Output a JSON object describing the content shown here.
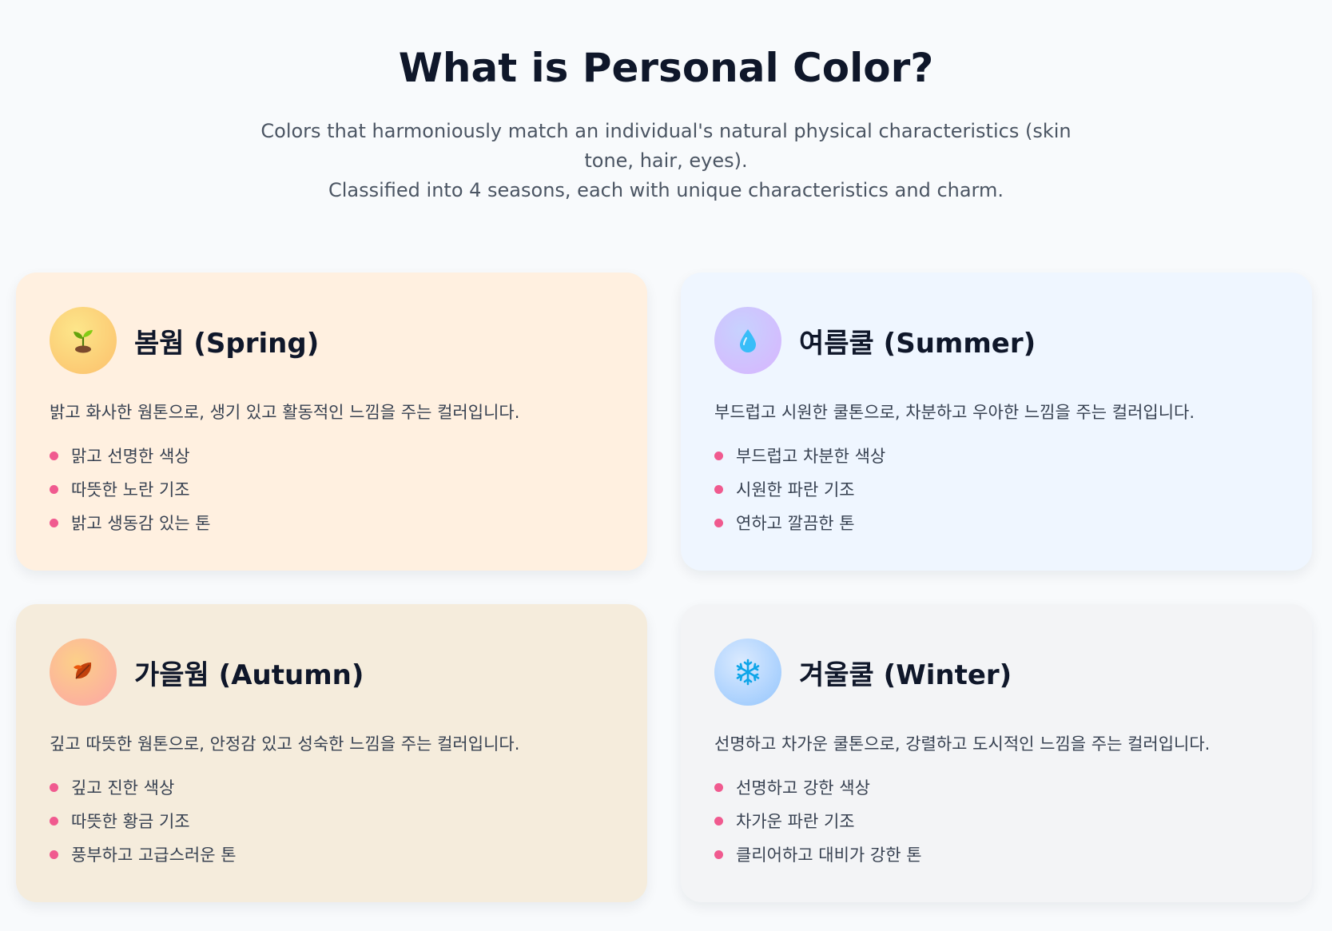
{
  "header": {
    "title": "What is Personal Color?",
    "subtitle_line1": "Colors that harmoniously match an individual's natural physical characteristics (skin tone, hair, eyes).",
    "subtitle_line2": "Classified into 4 seasons, each with unique characteristics and charm."
  },
  "colors": {
    "bullet": "#f05a8f",
    "spring_bg": "#fff0e0",
    "summer_bg": "#eff6ff",
    "autumn_bg": "#f5ecdc",
    "winter_bg": "#f3f4f6"
  },
  "seasons": [
    {
      "key": "spring",
      "icon": "seedling-icon",
      "title": "봄웜 (Spring)",
      "description": "밝고 화사한 웜톤으로, 생기 있고 활동적인 느낌을 주는 컬러입니다.",
      "traits": [
        "맑고 선명한 색상",
        "따뜻한 노란 기조",
        "밝고 생동감 있는 톤"
      ]
    },
    {
      "key": "summer",
      "icon": "droplet-icon",
      "title": "여름쿨 (Summer)",
      "description": "부드럽고 시원한 쿨톤으로, 차분하고 우아한 느낌을 주는 컬러입니다.",
      "traits": [
        "부드럽고 차분한 색상",
        "시원한 파란 기조",
        "연하고 깔끔한 톤"
      ]
    },
    {
      "key": "autumn",
      "icon": "fallen-leaf-icon",
      "title": "가을웜 (Autumn)",
      "description": "깊고 따뜻한 웜톤으로, 안정감 있고 성숙한 느낌을 주는 컬러입니다.",
      "traits": [
        "깊고 진한 색상",
        "따뜻한 황금 기조",
        "풍부하고 고급스러운 톤"
      ]
    },
    {
      "key": "winter",
      "icon": "snowflake-icon",
      "title": "겨울쿨 (Winter)",
      "description": "선명하고 차가운 쿨톤으로, 강렬하고 도시적인 느낌을 주는 컬러입니다.",
      "traits": [
        "선명하고 강한 색상",
        "차가운 파란 기조",
        "클리어하고 대비가 강한 톤"
      ]
    }
  ]
}
